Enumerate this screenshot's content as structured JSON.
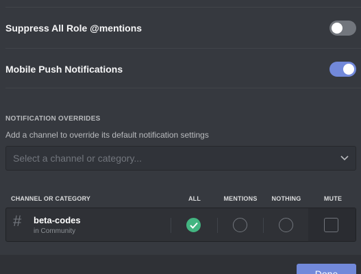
{
  "settings": {
    "suppress_roles": {
      "label": "Suppress All Role @mentions",
      "enabled": false
    },
    "mobile_push": {
      "label": "Mobile Push Notifications",
      "enabled": true
    }
  },
  "overrides": {
    "section_title": "NOTIFICATION OVERRIDES",
    "description": "Add a channel to override its default notification settings",
    "select_placeholder": "Select a channel or category...",
    "table_headers": {
      "channel": "CHANNEL OR CATEGORY",
      "all": "ALL",
      "mentions": "MENTIONS",
      "nothing": "NOTHING",
      "mute": "MUTE"
    },
    "rows": [
      {
        "icon": "hash-icon",
        "name": "beta-codes",
        "subtitle": "in Community",
        "selected": "all",
        "muted": false
      }
    ]
  },
  "footer": {
    "done_label": "Done"
  },
  "colors": {
    "background": "#36393f",
    "accent": "#7289da",
    "success": "#43b581",
    "toggle_off": "#72767d"
  }
}
